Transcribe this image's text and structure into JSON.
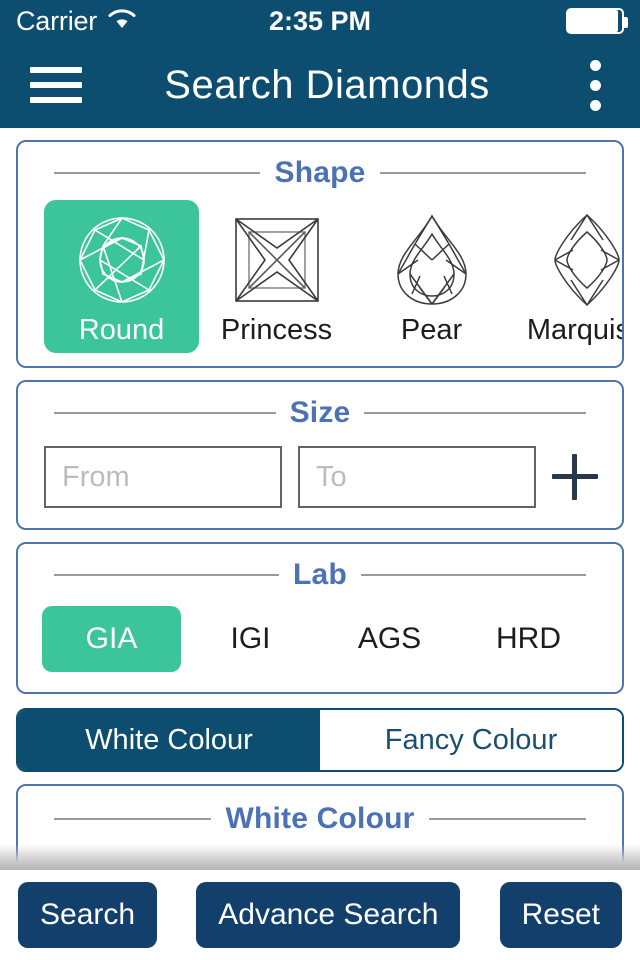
{
  "status_bar": {
    "carrier": "Carrier",
    "wifi_icon": "wifi-icon",
    "time": "2:35 PM",
    "battery_icon": "battery-full-icon",
    "battery_level_pct": 92
  },
  "nav_bar": {
    "menu_icon": "hamburger-menu-icon",
    "title": "Search Diamonds",
    "overflow_icon": "kebab-menu-icon"
  },
  "sections": {
    "shape": {
      "title": "Shape",
      "items": [
        {
          "label": "Round",
          "icon": "round-diamond-icon",
          "selected": true
        },
        {
          "label": "Princess",
          "icon": "princess-diamond-icon",
          "selected": false
        },
        {
          "label": "Pear",
          "icon": "pear-diamond-icon",
          "selected": false
        },
        {
          "label": "Marquise",
          "icon": "marquise-diamond-icon",
          "selected": false
        }
      ]
    },
    "size": {
      "title": "Size",
      "from": {
        "value": "",
        "placeholder": "From"
      },
      "to": {
        "value": "",
        "placeholder": "To"
      },
      "add_icon": "plus-icon"
    },
    "lab": {
      "title": "Lab",
      "options": [
        {
          "label": "GIA",
          "selected": true
        },
        {
          "label": "IGI",
          "selected": false
        },
        {
          "label": "AGS",
          "selected": false
        },
        {
          "label": "HRD",
          "selected": false
        }
      ]
    },
    "colour_toggle": {
      "segments": [
        {
          "label": "White Colour",
          "active": true
        },
        {
          "label": "Fancy Colour",
          "active": false
        }
      ]
    },
    "white_colour": {
      "title": "White Colour"
    }
  },
  "bottom_bar": {
    "buttons": [
      {
        "label": "Search"
      },
      {
        "label": "Advance Search"
      },
      {
        "label": "Reset"
      }
    ]
  },
  "colors": {
    "header_navy": "#0d4d70",
    "accent_green": "#3cc49a",
    "section_title_blue": "#4a72b5",
    "card_border_blue": "#4d74ad",
    "button_navy": "#123f6b"
  }
}
